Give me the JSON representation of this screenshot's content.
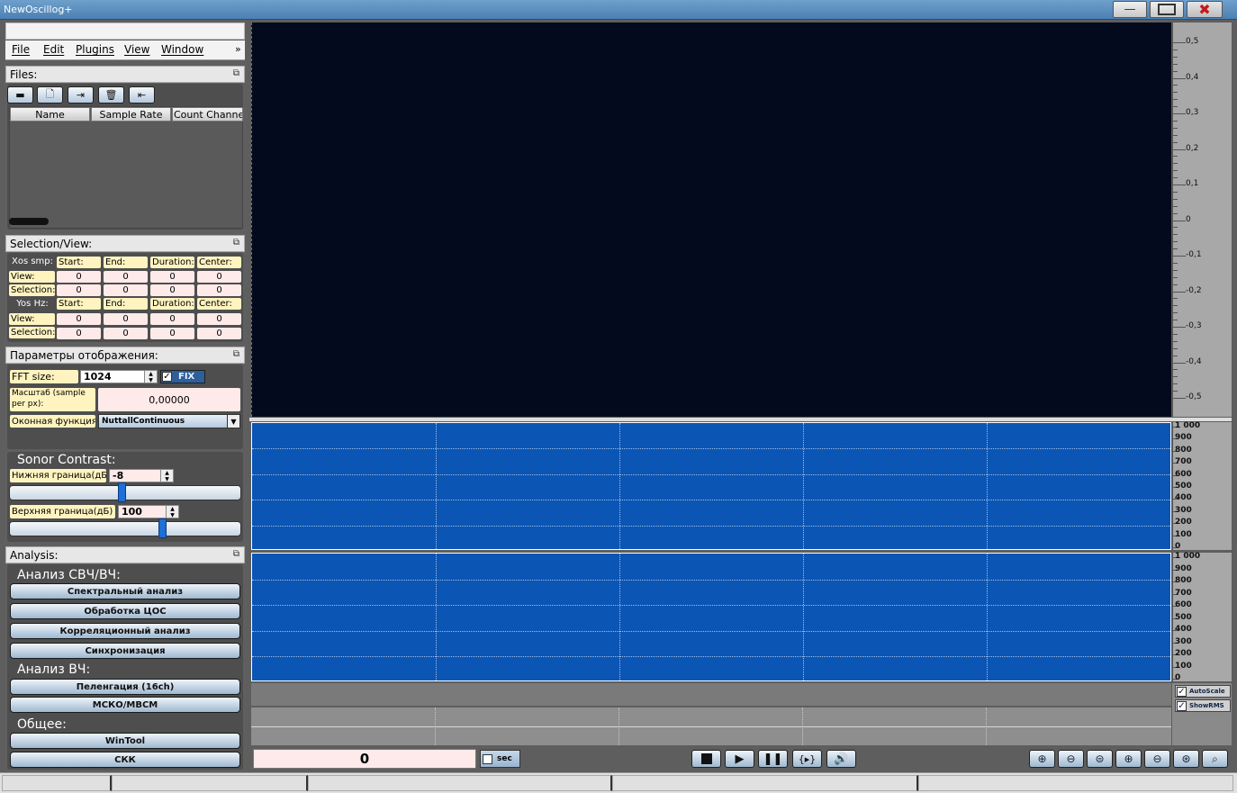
{
  "window": {
    "title": "NewOscillog+"
  },
  "menu": {
    "items": [
      "File",
      "Edit",
      "Plugins",
      "View",
      "Window"
    ],
    "more": "»"
  },
  "files": {
    "header": "Files:",
    "toolbar": [
      "open-folder-icon",
      "new-file-icon",
      "import-icon",
      "trash-icon",
      "export-icon"
    ],
    "columns": [
      "Name",
      "Sample Rate",
      "Count Channe"
    ]
  },
  "selection": {
    "header": "Selection/View:",
    "xos_label": "Xos smp:",
    "yos_label": "Yos Hz:",
    "col_labels": [
      "Start:",
      "End:",
      "Duration:",
      "Center:"
    ],
    "row_labels": [
      "View:",
      "Selection:"
    ],
    "values": "0"
  },
  "display": {
    "header": "Параметры отображения:",
    "fft_label": "FFT size:",
    "fft_value": "1024",
    "fix_label": "FIX",
    "scale_label": "Масштаб (sample per px):",
    "scale_value": "0,00000",
    "window_label": "Оконная функция:",
    "window_value": "NuttallContinuous"
  },
  "contrast": {
    "header": "Sonor Contrast:",
    "lower_label": "Нижняя граница(дБ)",
    "lower_value": "-8",
    "upper_label": "Верхняя граница(дБ)",
    "upper_value": "100",
    "lower_slider": 0.48,
    "upper_slider": 0.66
  },
  "analysis": {
    "header": "Analysis:",
    "group1": "Анализ СВЧ/ВЧ:",
    "group1_buttons": [
      "Спектральный анализ",
      "Обработка ЦОС",
      "Корреляционный анализ",
      "Синхронизация"
    ],
    "group2": "Анализ ВЧ:",
    "group2_buttons": [
      "Пеленгация (16ch)",
      "МСКО/МВСМ"
    ],
    "group3": "Общее:",
    "group3_buttons": [
      "WinTool",
      "СКК"
    ]
  },
  "osc_axis": [
    "0,5",
    "0,4",
    "0,3",
    "0,2",
    "0,1",
    "0",
    "-0,1",
    "-0,2",
    "-0,3",
    "-0,4",
    "-0,5"
  ],
  "spectro_axis": [
    "1 000",
    "900",
    "800",
    "700",
    "600",
    "500",
    "400",
    "300",
    "200",
    "100",
    "0"
  ],
  "checks": {
    "autoscale": "AutoScale",
    "showrms": "ShowRMS"
  },
  "counter": {
    "value": "0",
    "unit": "sec"
  },
  "colors": {
    "osc_bg": "#040a1e",
    "spectro_bg": "#0b55b4",
    "accent": "#1e6fd6"
  }
}
